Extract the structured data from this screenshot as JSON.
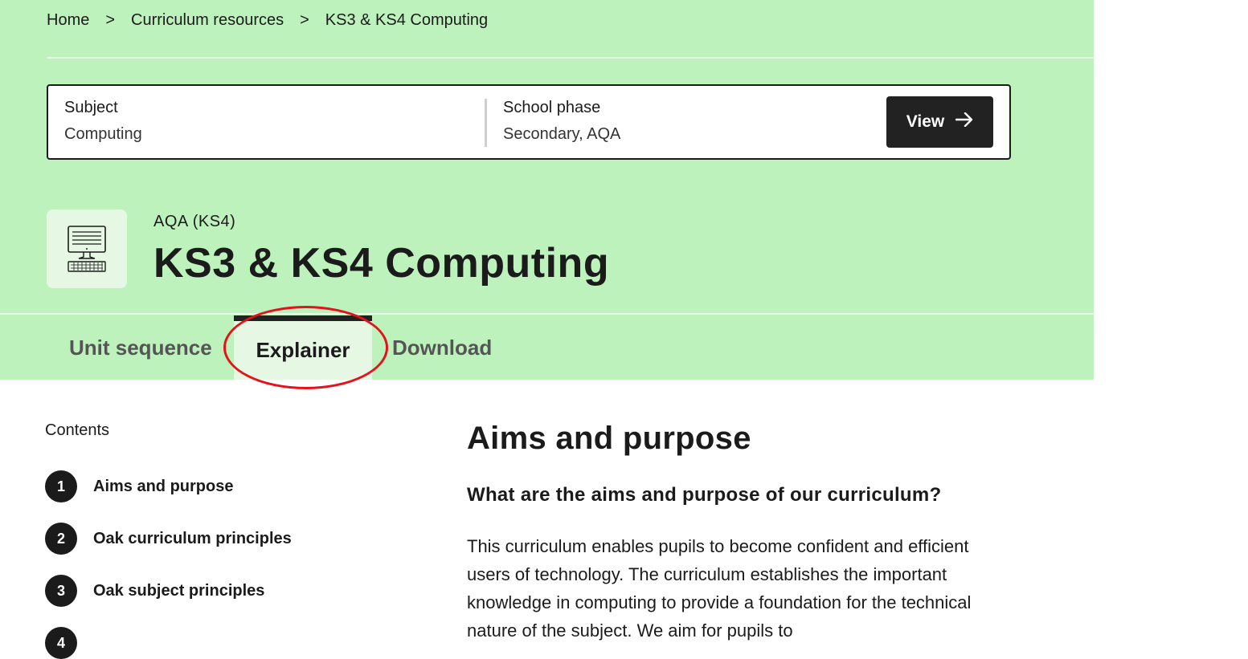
{
  "breadcrumb": {
    "items": [
      "Home",
      "Curriculum resources",
      "KS3 & KS4 Computing"
    ],
    "separator": ">"
  },
  "filter": {
    "subject_label": "Subject",
    "subject_value": "Computing",
    "phase_label": "School phase",
    "phase_value": "Secondary, AQA",
    "view_button": "View",
    "view_icon": "arrow-right-icon"
  },
  "header": {
    "icon": "computer-icon",
    "exam_board": "AQA (KS4)",
    "title": "KS3 & KS4 Computing"
  },
  "tabs": [
    {
      "label": "Unit sequence",
      "active": false
    },
    {
      "label": "Explainer",
      "active": true
    },
    {
      "label": "Download",
      "active": false
    }
  ],
  "annotation_color": "#e3121b",
  "contents": {
    "label": "Contents",
    "items": [
      {
        "num": "1",
        "label": "Aims and purpose"
      },
      {
        "num": "2",
        "label": "Oak curriculum principles"
      },
      {
        "num": "3",
        "label": "Oak subject principles"
      },
      {
        "num": "4",
        "label": ""
      }
    ]
  },
  "main": {
    "heading": "Aims and purpose",
    "subheading": "What are the aims and purpose of our curriculum?",
    "paragraph": "This curriculum enables pupils to become confident and efficient users of technology. The curriculum establishes the important knowledge in computing to provide a foundation for the technical nature of the subject. We aim for pupils to"
  },
  "colors": {
    "hero_bg": "#bef2bd",
    "tab_active_bg": "#e6f8e4",
    "button_bg": "#222222"
  }
}
